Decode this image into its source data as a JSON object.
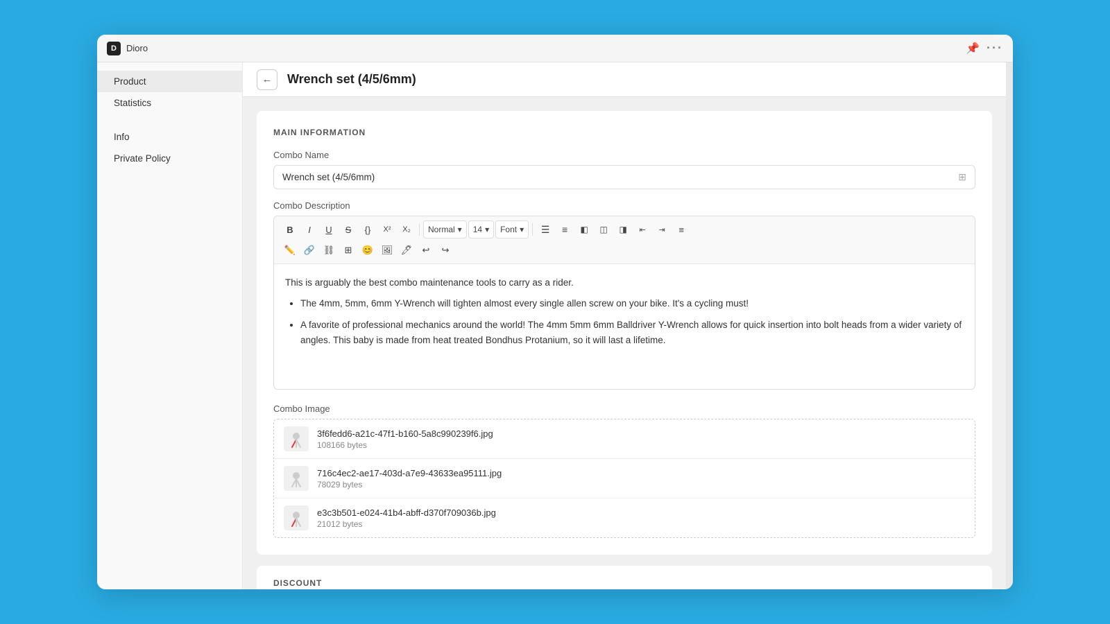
{
  "app": {
    "logo": "D",
    "name": "Dioro"
  },
  "titlebar": {
    "pin_icon": "📌",
    "more_icon": "···"
  },
  "sidebar": {
    "items": [
      {
        "id": "product",
        "label": "Product",
        "active": true
      },
      {
        "id": "statistics",
        "label": "Statistics",
        "active": false
      },
      {
        "id": "info",
        "label": "Info",
        "active": false
      },
      {
        "id": "private-policy",
        "label": "Private Policy",
        "active": false
      }
    ]
  },
  "topbar": {
    "back_icon": "←",
    "title": "Wrench set (4/5/6mm)"
  },
  "main_info": {
    "section_title": "MAIN INFORMATION",
    "combo_name_label": "Combo Name",
    "combo_name_value": "Wrench set (4/5/6mm)",
    "combo_desc_label": "Combo Description",
    "toolbar": {
      "bold": "B",
      "italic": "I",
      "underline": "U",
      "strike": "S",
      "code": "{}",
      "sup": "X²",
      "sub": "X₂",
      "style_select": "Normal",
      "style_arrow": "▾",
      "size_select": "14",
      "size_arrow": "▾",
      "font_select": "Font",
      "font_arrow": "▾"
    },
    "editor_text": "This is arguably the best combo maintenance tools to carry as a rider.",
    "editor_bullets": [
      "The 4mm, 5mm, 6mm Y-Wrench will tighten almost every single allen screw on your bike. It's a cycling must!",
      "A favorite of professional mechanics around the world! The 4mm 5mm 6mm Balldriver Y-Wrench allows for quick insertion into bolt heads from a wider variety of angles. This baby is made from heat treated Bondhus Protanium, so it will last a lifetime."
    ],
    "combo_image_label": "Combo Image",
    "images": [
      {
        "name": "3f6fedd6-a21c-47f1-b160-5a8c990239f6.jpg",
        "size": "108166 bytes"
      },
      {
        "name": "716c4ec2-ae17-403d-a7e9-43633ea95111.jpg",
        "size": "78029 bytes"
      },
      {
        "name": "e3c3b501-e024-41b4-abff-d370f709036b.jpg",
        "size": "21012 bytes"
      }
    ]
  },
  "discount": {
    "section_title": "DISCOUNT"
  }
}
